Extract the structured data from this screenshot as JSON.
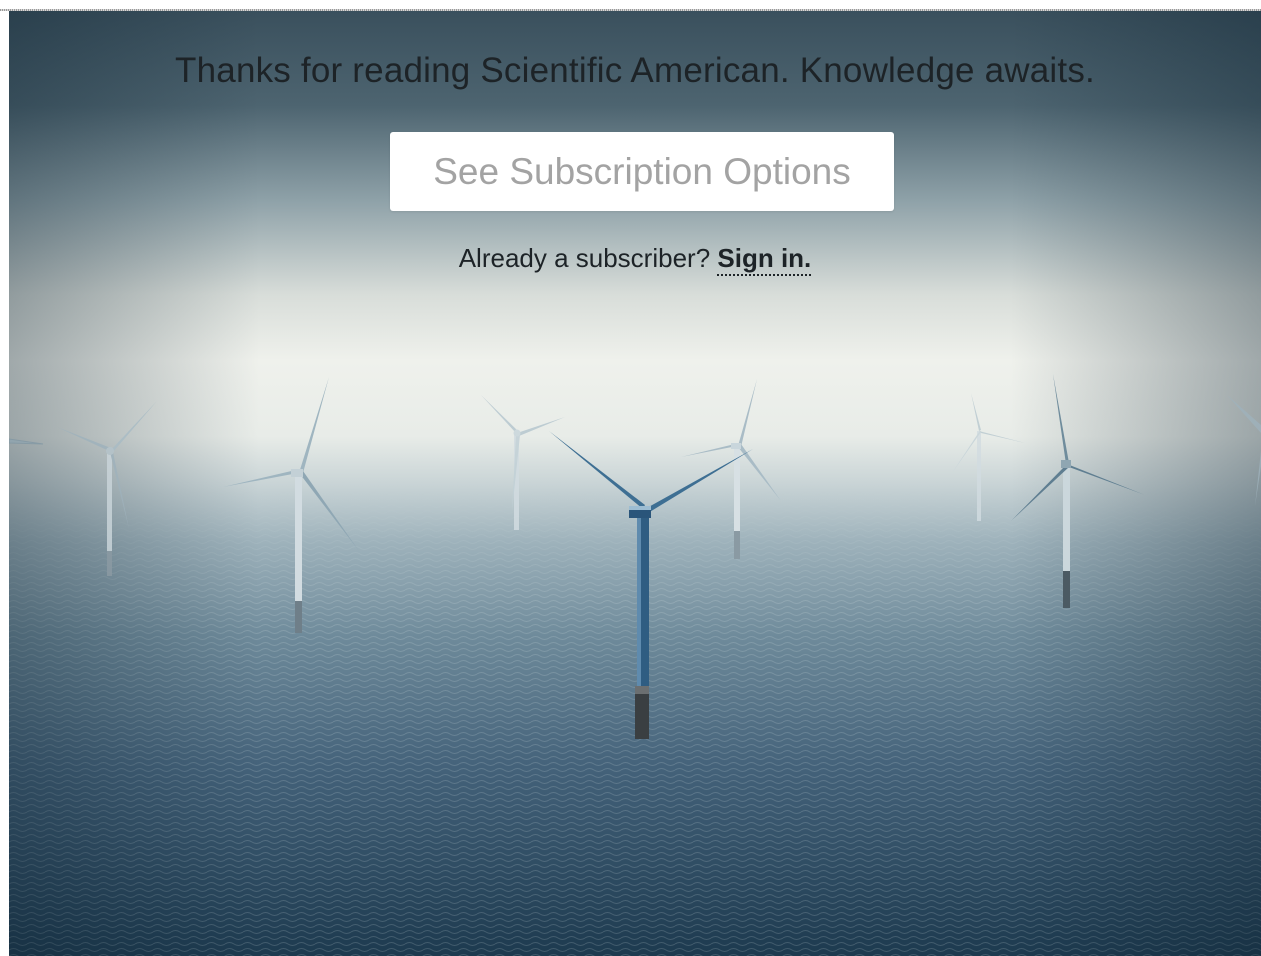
{
  "paywall": {
    "headline": "Thanks for reading Scientific American. Knowledge awaits.",
    "cta_label": "See Subscription Options",
    "signin_prompt": "Already a subscriber?",
    "signin_link": "Sign in."
  },
  "background": {
    "image_subject": "offshore-wind-turbines-icon",
    "colors": {
      "sky_top": "#3f5663",
      "sky_haze": "#eef0ec",
      "sea_mid": "#7d98a6",
      "sea_deep": "#1f3c50",
      "text": "#1d2327",
      "button_text": "#a3a3a3",
      "button_bg": "#ffffff"
    }
  }
}
